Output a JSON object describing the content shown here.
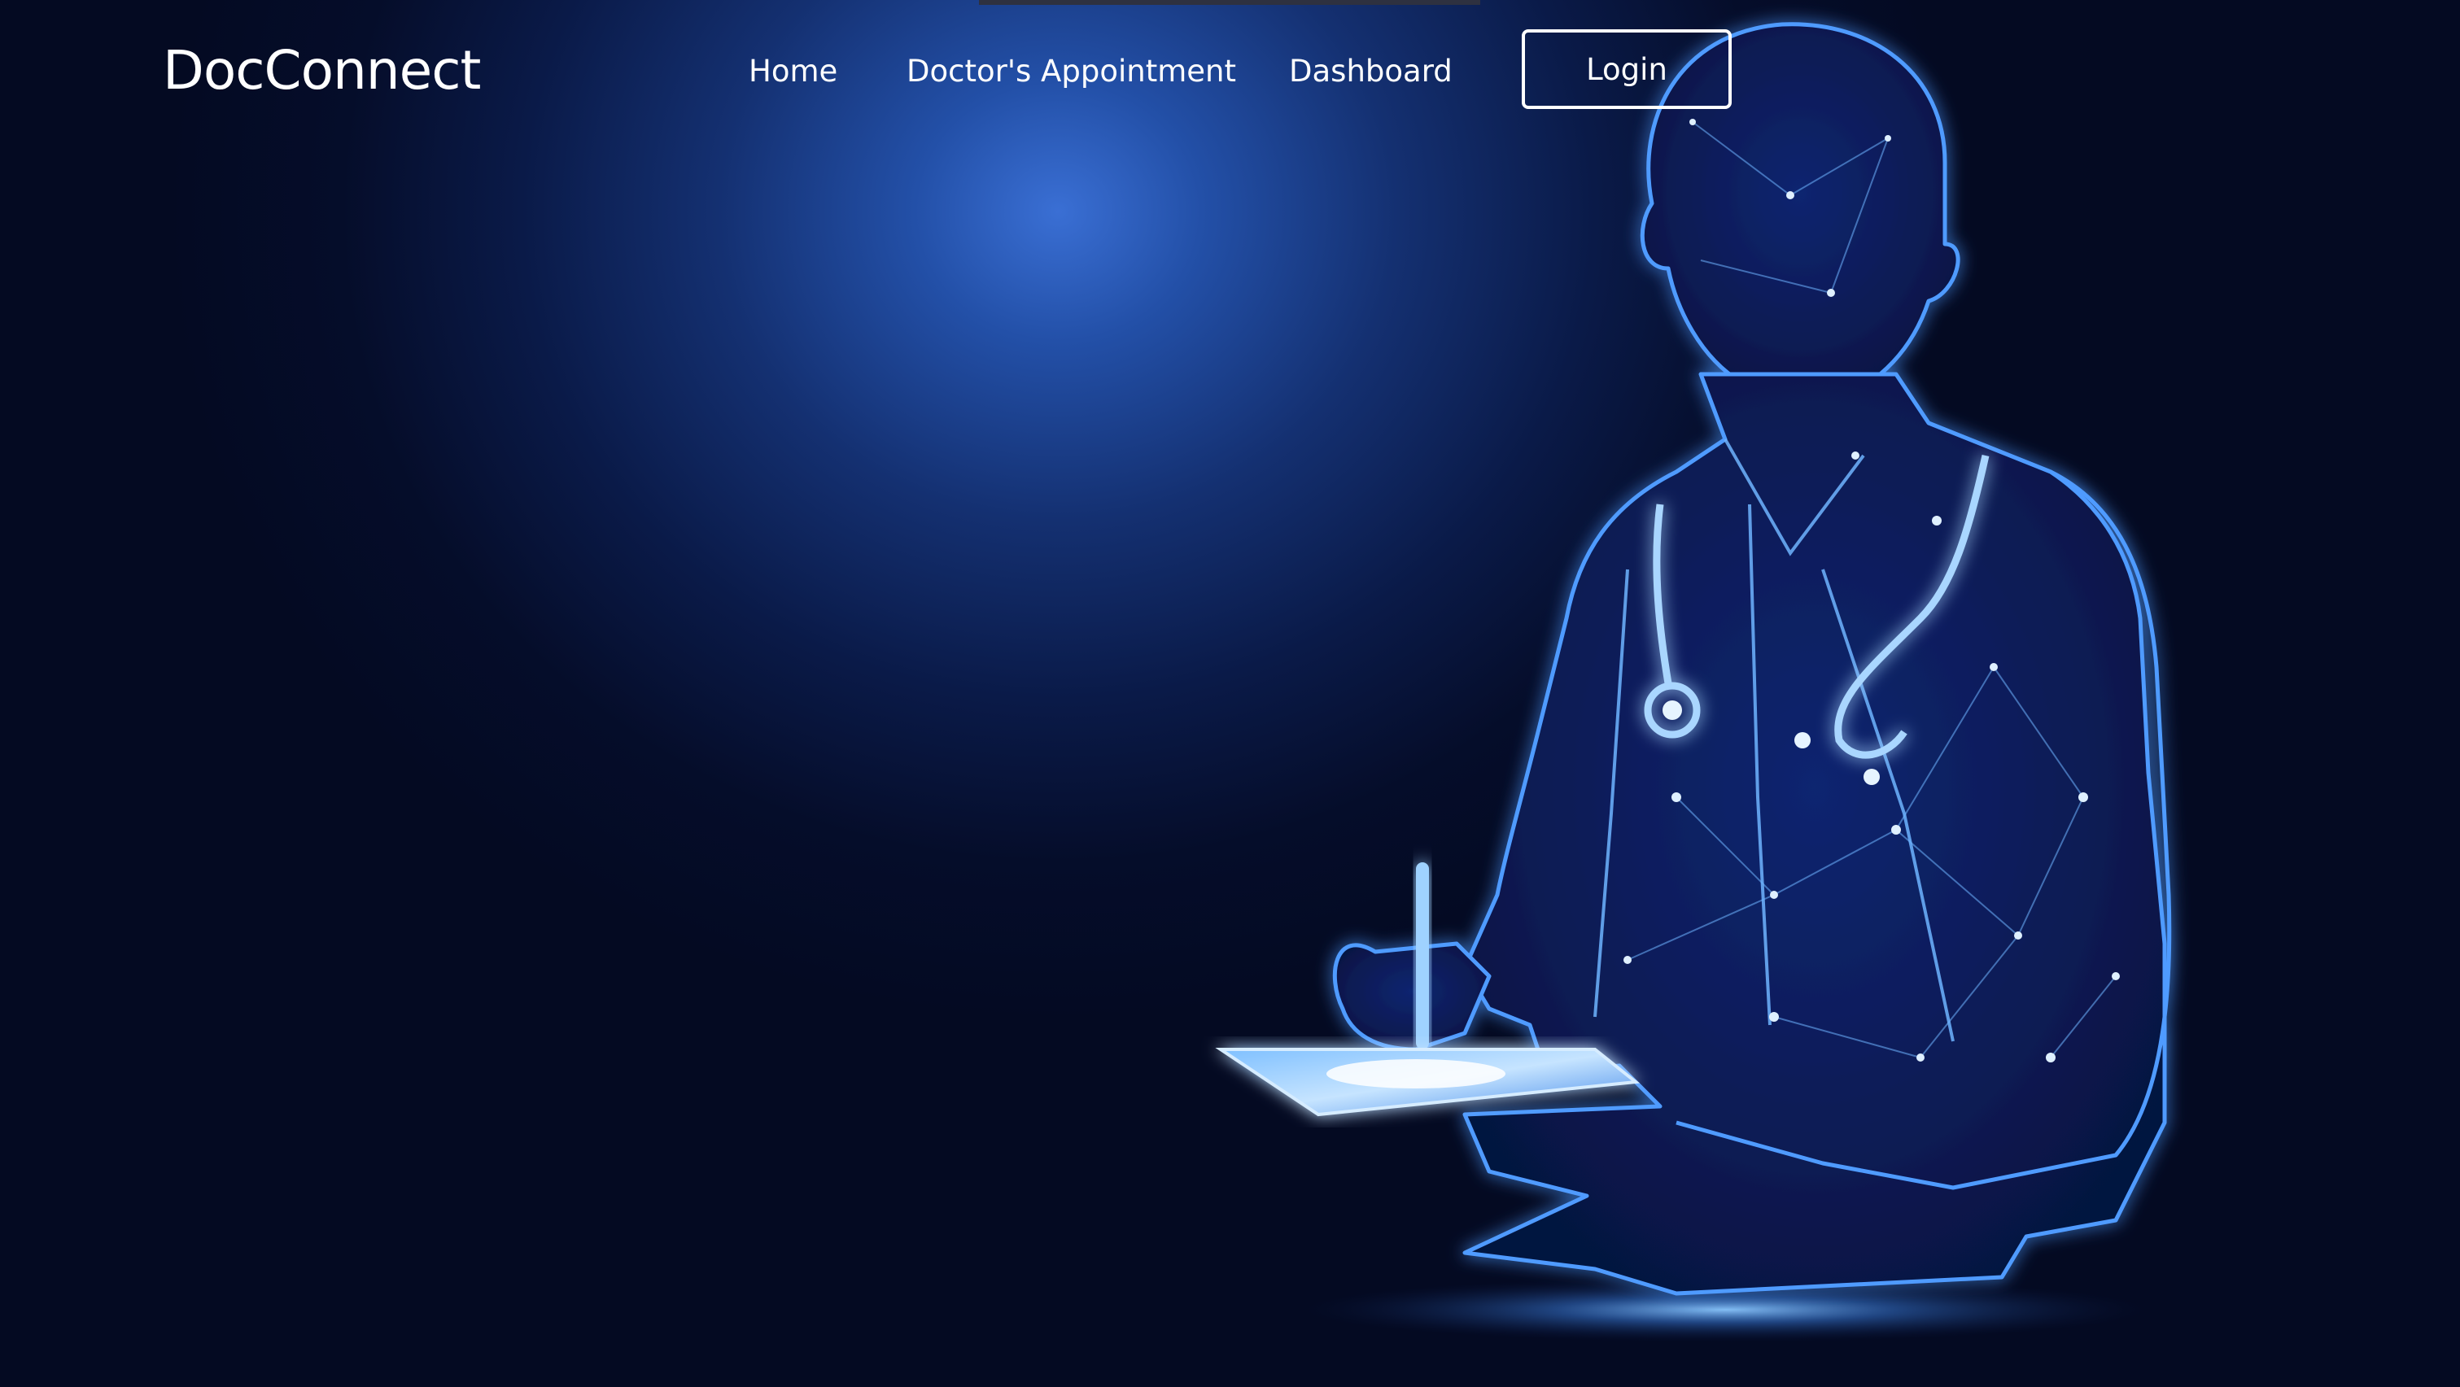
{
  "brand": {
    "name": "DocConnect"
  },
  "nav": {
    "links": [
      {
        "label": "Home"
      },
      {
        "label": "Doctor's Appointment"
      },
      {
        "label": "Dashboard"
      }
    ],
    "login_label": "Login"
  },
  "hero": {
    "illustration": "doctor-with-stethoscope-and-tablet-illustration"
  },
  "colors": {
    "background": "#040b22",
    "glow": "#3a6fd4",
    "illustration": "#4f9bff",
    "text": "#ffffff"
  }
}
